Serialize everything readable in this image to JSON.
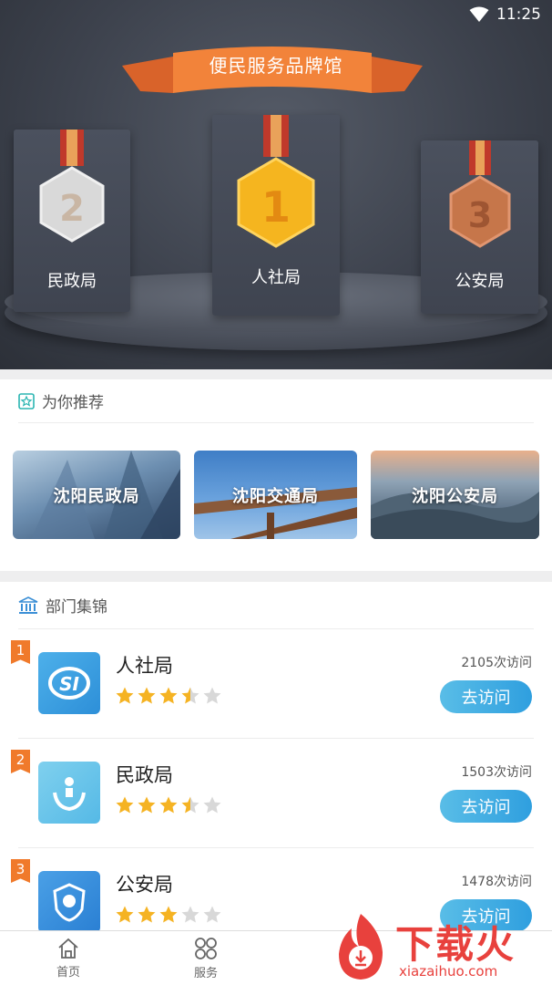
{
  "status_bar": {
    "time": "11:25"
  },
  "hero": {
    "banner_title": "便民服务品牌馆",
    "medals": [
      {
        "rank": "2",
        "label": "民政局"
      },
      {
        "rank": "1",
        "label": "人社局"
      },
      {
        "rank": "3",
        "label": "公安局"
      }
    ]
  },
  "recommend": {
    "title": "为你推荐",
    "tiles": [
      "沈阳民政局",
      "沈阳交通局",
      "沈阳公安局"
    ]
  },
  "departments": {
    "title": "部门集锦",
    "items": [
      {
        "rank": "1",
        "name": "人社局",
        "visits": "2105次访问",
        "rating": 3.5,
        "button": "去访问",
        "logo_text": "SI"
      },
      {
        "rank": "2",
        "name": "民政局",
        "visits": "1503次访问",
        "rating": 3.5,
        "button": "去访问"
      },
      {
        "rank": "3",
        "name": "公安局",
        "visits": "1478次访问",
        "rating": 3,
        "button": "去访问"
      }
    ]
  },
  "tabbar": {
    "home": "首页",
    "service": "服务"
  },
  "watermark": {
    "brand": "下载火",
    "url": "xiazaihuo.com"
  },
  "colors": {
    "accent": "#2f9fdf",
    "rank_badge": "#f07a2b",
    "star": "#f5b323"
  }
}
